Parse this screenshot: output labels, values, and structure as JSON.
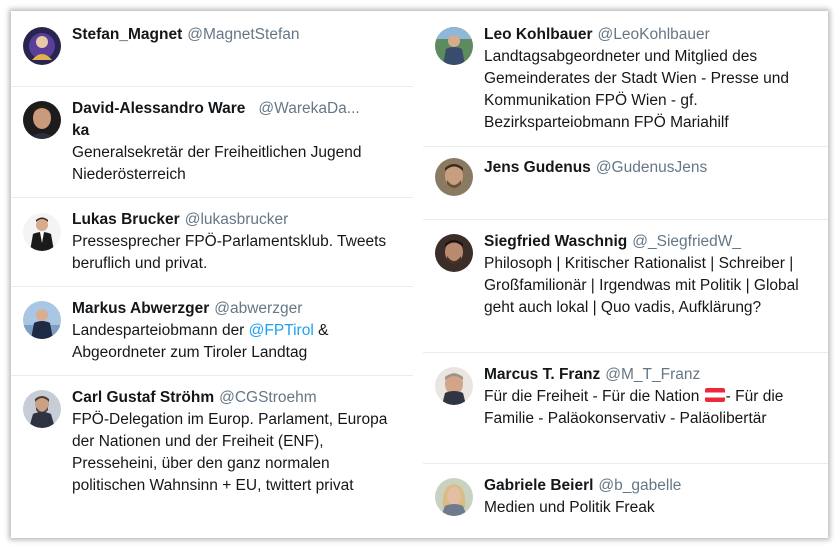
{
  "left": [
    {
      "name": "Stefan_Magnet",
      "handle": "@MagnetStefan",
      "bio": ""
    },
    {
      "name": "David-Alessandro Ware",
      "name_wrap": "ka",
      "handle": "@WarekaDa...",
      "bio": "Generalsekretär der Freiheitlichen Jugend Niederösterreich"
    },
    {
      "name": "Lukas Brucker",
      "handle": "@lukasbrucker",
      "bio": "Pressesprecher FPÖ-Parlamentsklub. Tweets beruflich und privat."
    },
    {
      "name": "Markus Abwerzger",
      "handle": "@abwerzger",
      "bio_pre": "Landesparteiobmann der",
      "bio_mention": "@FPTirol",
      "bio_post": "& Abgeordneter zum Tiroler Landtag"
    },
    {
      "name": "Carl Gustaf Ströhm",
      "handle": "@CGStroehm",
      "bio": "FPÖ-Delegation im Europ. Parlament, Europa der Nationen und der Freiheit (ENF), Presseheini, über den ganz normalen politischen Wahnsinn + EU, twittert privat"
    }
  ],
  "right": [
    {
      "name": "Leo Kohlbauer",
      "handle": "@LeoKohlbauer",
      "bio": "Landtagsabgeordneter und Mitglied des Gemeinderates der Stadt Wien - Presse und Kommunikation FPÖ Wien - gf. Bezirksparteiobmann FPÖ Mariahilf"
    },
    {
      "name": "Jens Gudenus",
      "handle": "@GudenusJens",
      "bio": ""
    },
    {
      "name": "Siegfried Waschnig",
      "handle": "@_SiegfriedW_",
      "bio": "Philosoph | Kritischer Rationalist | Schreiber | Großfamilionär | Irgendwas mit Politik | Global geht auch lokal | Quo vadis, Aufklärung?"
    },
    {
      "name": "Marcus T. Franz",
      "handle": "@M_T_Franz",
      "bio_pre": "Für die Freiheit - Für die Nation",
      "bio_post": "- Für die Familie - Paläokonservativ - Paläolibertär"
    },
    {
      "name": "Gabriele Beierl",
      "handle": "@b_gabelle",
      "bio": "Medien und Politik Freak"
    }
  ]
}
